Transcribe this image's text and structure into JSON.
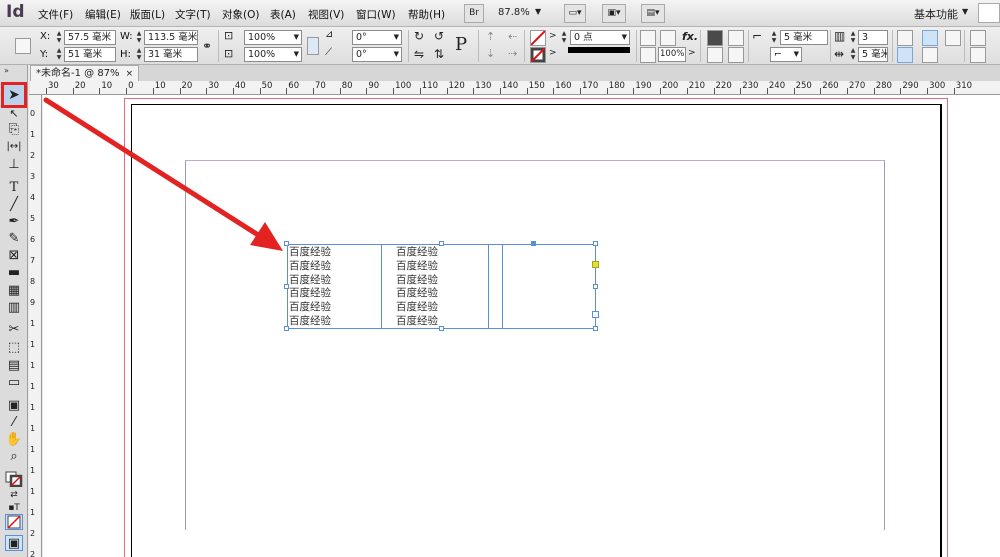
{
  "app": {
    "logo": "Id"
  },
  "menu": [
    "文件(F)",
    "编辑(E)",
    "版面(L)",
    "文字(T)",
    "对象(O)",
    "表(A)",
    "视图(V)",
    "窗口(W)",
    "帮助(H)"
  ],
  "menubar": {
    "bridge_label": "Br",
    "zoom": "87.8%",
    "workspace": "基本功能"
  },
  "control": {
    "x_label": "X:",
    "x_value": "57.5 毫米",
    "y_label": "Y:",
    "y_value": "51 毫米",
    "w_label": "W:",
    "w_value": "113.5 毫米",
    "h_label": "H:",
    "h_value": "31 毫米",
    "scale_x": "100%",
    "scale_y": "100%",
    "rotate": "0°",
    "shear": "0°",
    "stroke_weight": "0 点",
    "opacity": "100%",
    "fx_label": "fx.",
    "text_wrap_offset": "5 毫米",
    "columns": "3",
    "gutter": "5 毫米"
  },
  "document_tab": {
    "title": "*未命名-1 @ 87%",
    "close": "×"
  },
  "ruler_top": [
    "30",
    "20",
    "10",
    "0",
    "10",
    "20",
    "30",
    "40",
    "50",
    "60",
    "70",
    "80",
    "90",
    "100",
    "110",
    "120",
    "130",
    "140",
    "150",
    "160",
    "170",
    "180",
    "190",
    "200",
    "210",
    "220",
    "230",
    "240",
    "250",
    "260",
    "270",
    "280",
    "290",
    "300",
    "310"
  ],
  "ruler_left": [
    "0",
    "1",
    "2",
    "3",
    "4",
    "5",
    "6",
    "7",
    "8",
    "9",
    "1",
    "1",
    "1",
    "1",
    "1",
    "1",
    "1",
    "1",
    "1",
    "1",
    "2",
    "2"
  ],
  "table": {
    "column1": [
      "百度经验",
      "百度经验",
      "百度经验",
      "百度经验",
      "百度经验",
      "百度经验"
    ],
    "column2": [
      "百度经验",
      "百度经验",
      "百度经验",
      "百度经验",
      "百度经验",
      "百度经验"
    ]
  },
  "tools": [
    "select-tool",
    "direct-select-tool",
    "page-tool",
    "gap-tool",
    "content-collector-tool",
    "type-tool",
    "line-tool",
    "pen-tool",
    "pencil-tool",
    "rectangle-frame-tool",
    "rectangle-tool",
    "table-grid-tool",
    "table-columns-tool",
    "scissors-tool",
    "free-transform-tool",
    "gradient-swatch-tool",
    "gradient-feather-tool",
    "note-tool",
    "eyedropper-tool",
    "hand-tool",
    "zoom-tool",
    "fill-stroke-icon",
    "swap-fill-stroke-icon",
    "format-text-icon",
    "apply-none-icon",
    "screen-mode-icon"
  ],
  "colors": {
    "annotation": "#e32222",
    "frame": "#5b8fd8",
    "bleed": "#e46a78"
  }
}
